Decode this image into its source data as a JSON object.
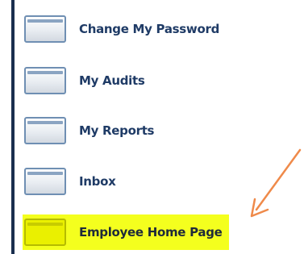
{
  "nav": {
    "items": [
      {
        "label": "Change My Password",
        "icon": "folder-tab-icon",
        "highlighted": false
      },
      {
        "label": "My Audits",
        "icon": "folder-tab-icon",
        "highlighted": false
      },
      {
        "label": "My Reports",
        "icon": "folder-tab-icon",
        "highlighted": false
      },
      {
        "label": "Inbox",
        "icon": "folder-tab-icon",
        "highlighted": false
      },
      {
        "label": "Employee Home Page",
        "icon": "folder-tab-icon",
        "highlighted": true
      }
    ]
  },
  "colors": {
    "label": "#1f3b66",
    "highlight": "#f4ff1e",
    "arrow": "#ef8a4a",
    "border": "#1a2f4f"
  }
}
